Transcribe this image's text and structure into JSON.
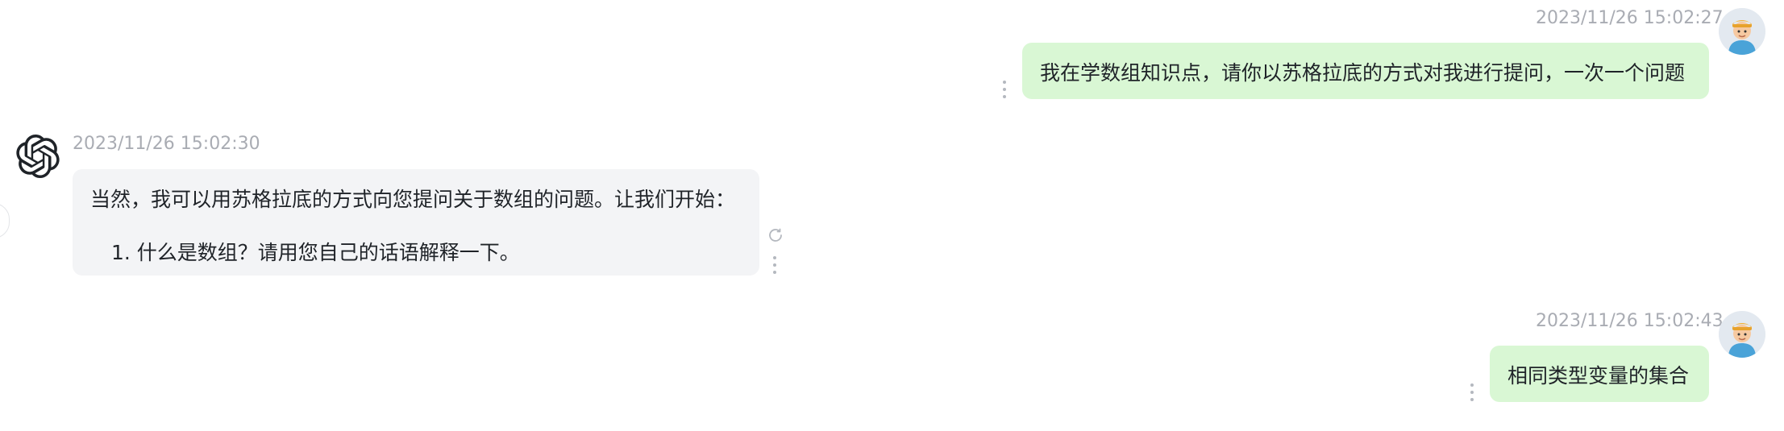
{
  "conversation": {
    "messages": [
      {
        "role": "user",
        "timestamp": "2023/11/26 15:02:27",
        "text": "我在学数组知识点，请你以苏格拉底的方式对我进行提问，一次一个问题"
      },
      {
        "role": "assistant",
        "timestamp": "2023/11/26 15:02:30",
        "intro": "当然，我可以用苏格拉底的方式向您提问关于数组的问题。让我们开始：",
        "list_item": "1. 什么是数组？请用您自己的话语解释一下。"
      },
      {
        "role": "user",
        "timestamp": "2023/11/26 15:02:43",
        "text": "相同类型变量的集合"
      }
    ]
  },
  "icons": {
    "user_avatar": "user-avatar",
    "assistant_avatar": "openai-logo-icon",
    "more": "more-vertical-icon",
    "regenerate": "refresh-icon"
  },
  "colors": {
    "user_bubble": "#d9f7d4",
    "assistant_bubble": "#f3f4f6",
    "timestamp": "#a9acb3",
    "text": "#1f2328"
  }
}
